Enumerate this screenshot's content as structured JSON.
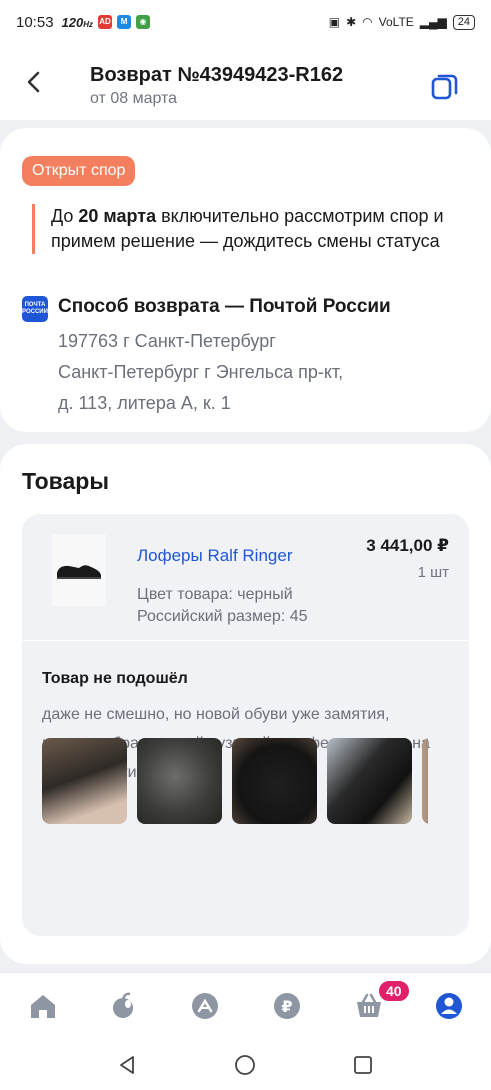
{
  "status_bar": {
    "time": "10:53",
    "speed": "120",
    "speed_unit": "Hz",
    "network": "VoLTE",
    "battery": "24"
  },
  "header": {
    "title": "Возврат №43949423-R162",
    "subtitle": "от 08 марта"
  },
  "dispute": {
    "badge": "Открыт спор",
    "notice_prefix": "До ",
    "notice_date": "20 марта",
    "notice_rest": " включительно рассмотрим спор и примем решение — дождитесь смены статуса",
    "post_logo_line1": "ПОЧТА",
    "post_logo_line2": "РОССИИ",
    "method_title": "Способ возврата — Почтой России",
    "address_line1": "197763 г Санкт-Петербург",
    "address_line2": "Санкт-Петербург г Энгельса пр-кт,",
    "address_line3": "д. 113, литера А, к. 1"
  },
  "goods": {
    "section_title": "Товары",
    "item": {
      "name": "Лоферы Ralf Ringer",
      "price": "3 441,00 ₽",
      "qty": "1 шт",
      "color": "Цвет товара: черный",
      "size": "Российский размер: 45"
    },
    "reason_title": "Товар не подошёл",
    "reason_text": "даже не смешно, но новой обуви уже замятия, подошва брак с кучей пузырей и дефектов литья на каждом ботинке своя."
  },
  "tabbar": {
    "cart_count": "40",
    "accent": "#1f56d6"
  }
}
